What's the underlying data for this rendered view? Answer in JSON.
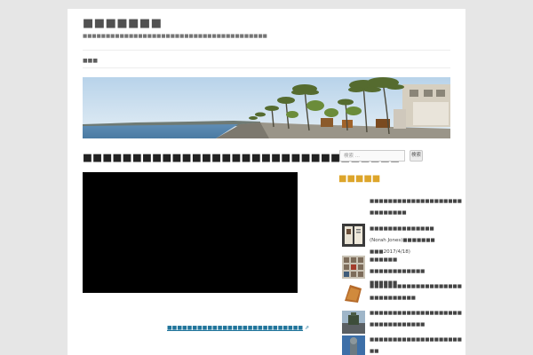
{
  "site": {
    "title": "■■■■■■■",
    "tagline": "■■■■■■■■■■■■■■■■■■■■■■■■■■■■■■■■■■■■■■■■"
  },
  "nav": {
    "home_label": "■■■"
  },
  "header_image": {
    "alt": ""
  },
  "post": {
    "title": "■■■■■■■■■■■■■■■■■■■■■■■■■■■■■■■■",
    "link_text": "■■■■■■■■■■■■■■■■■■■■■■■■■■■"
  },
  "sidebar": {
    "search": {
      "placeholder": "検索 ...",
      "button_label": "検索"
    },
    "widget_title": "■■■■■",
    "recent_posts": [
      {
        "line1": "■■■■■■■■■■■■■■■■■■■■",
        "line2": "■■■■■■■■"
      },
      {
        "line1": "■■■■■■■■■■■■■■",
        "line2": "(Norah Jones)■■■■■■■",
        "line3": "■■■2017/4/18)"
      },
      {
        "line1": "■■■■■■ ■■■■■■■■■■■■",
        "line2": "■■■■■■"
      },
      {
        "line1": "■■■■■■■■■■■■■■■■■■■■",
        "line2": "■■■■■■■■■■"
      },
      {
        "line1": "■■■■■■■■■■■■■■■■■■■■",
        "line2": "■■■■■■■■■■■■"
      },
      {
        "line1": "■■■■■■■■■■■■■■■■■■■■",
        "line2": "■■"
      }
    ]
  },
  "colors": {
    "page_bg": "#e6e6e6",
    "content_bg": "#ffffff",
    "link": "#21759b",
    "widget_title": "#dda52b"
  },
  "icons": {
    "external_link": "external-link-icon"
  }
}
